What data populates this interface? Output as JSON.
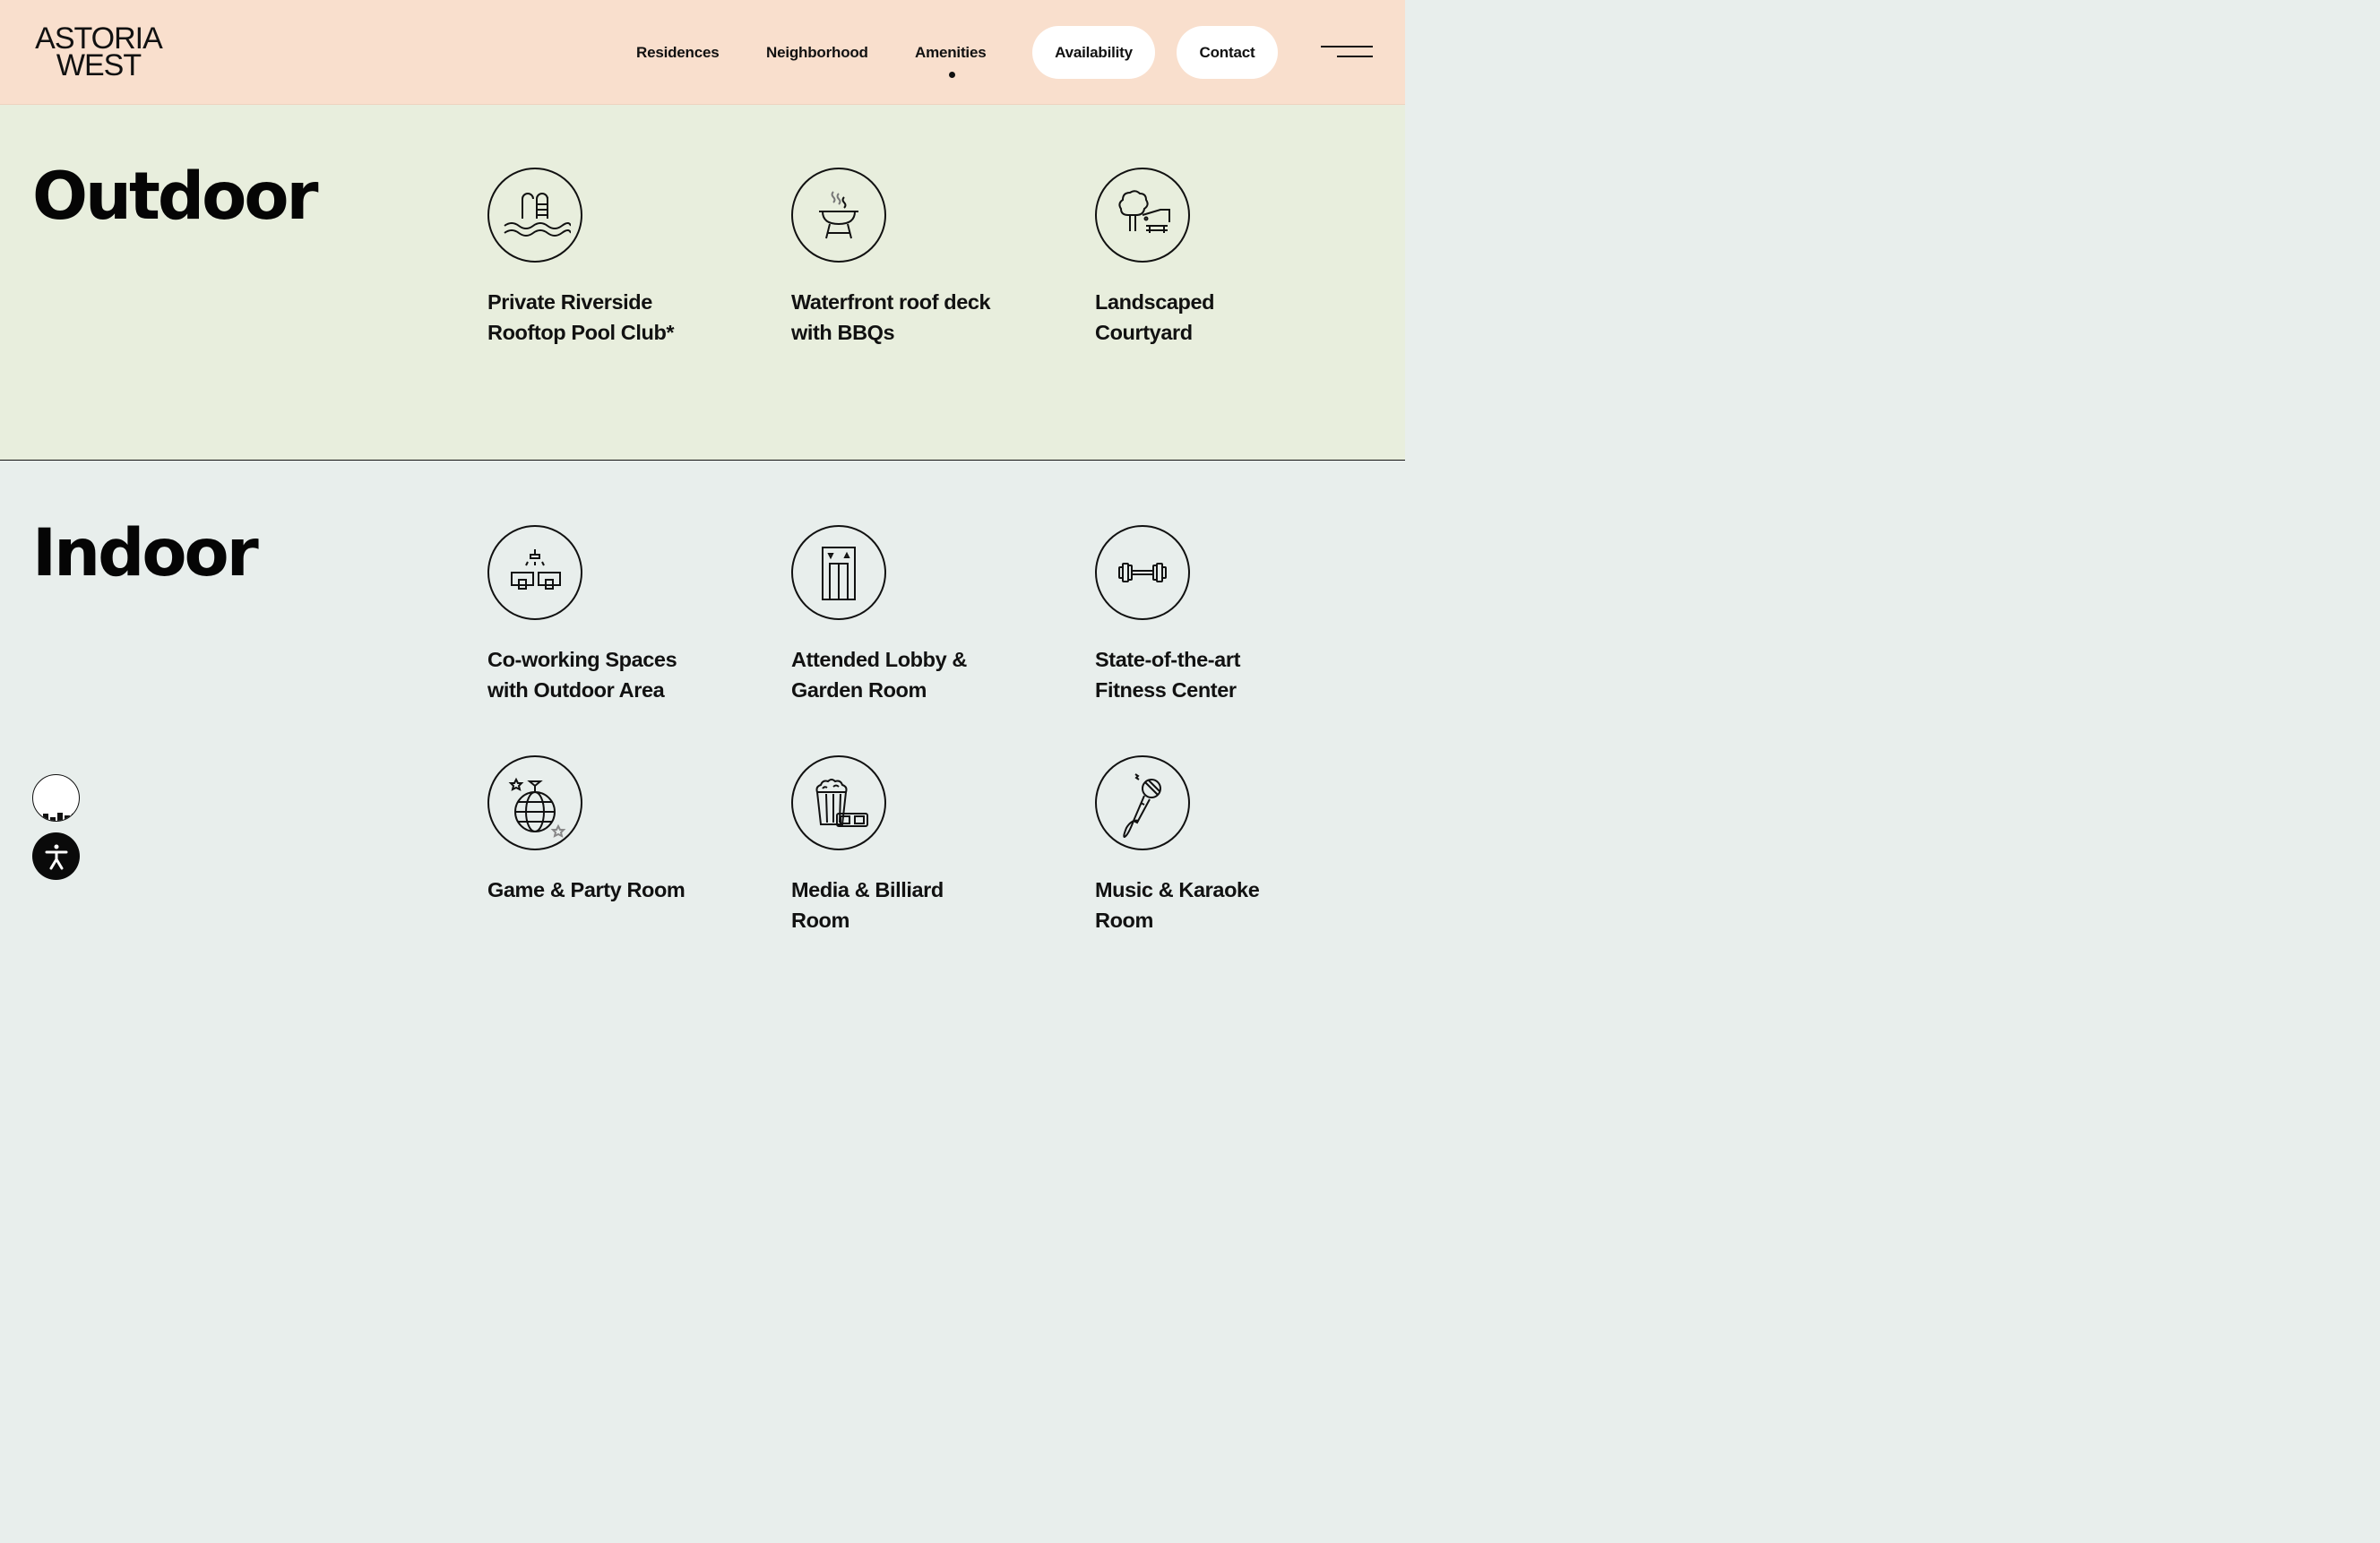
{
  "header": {
    "logo_line1": "ASTORIA",
    "logo_line2": "WEST",
    "nav": [
      "Residences",
      "Neighborhood",
      "Amenities"
    ],
    "active_nav": "Amenities",
    "availability_label": "Availability",
    "contact_label": "Contact",
    "menu_icon": "hamburger-menu-icon"
  },
  "outdoor": {
    "title": "Outdoor",
    "items": [
      {
        "label": "Private Riverside Rooftop Pool Club*",
        "icon": "pool-ladder-icon"
      },
      {
        "label": "Waterfront roof deck with BBQs",
        "icon": "bbq-grill-icon"
      },
      {
        "label": "Landscaped Courtyard",
        "icon": "tree-bench-icon"
      }
    ]
  },
  "indoor": {
    "title": "Indoor",
    "items": [
      {
        "label": "Co-working Spaces with Outdoor Area",
        "icon": "coworking-desks-icon"
      },
      {
        "label": "Attended Lobby & Garden Room",
        "icon": "elevator-door-icon"
      },
      {
        "label": "State-of-the-art Fitness Center",
        "icon": "dumbbell-icon"
      },
      {
        "label": "Game & Party Room",
        "icon": "disco-ball-icon"
      },
      {
        "label": "Media & Billiard Room",
        "icon": "popcorn-3d-glasses-icon"
      },
      {
        "label": "Music & Karaoke Room",
        "icon": "microphone-icon"
      }
    ]
  },
  "widgets": {
    "ring_icon": "audio-level-icon",
    "accessibility_icon": "accessibility-person-icon"
  },
  "colors": {
    "header_bg": "#f9dfcd",
    "outdoor_bg": "#e8eedd",
    "indoor_bg": "#e8eeec",
    "ink": "#111111"
  }
}
